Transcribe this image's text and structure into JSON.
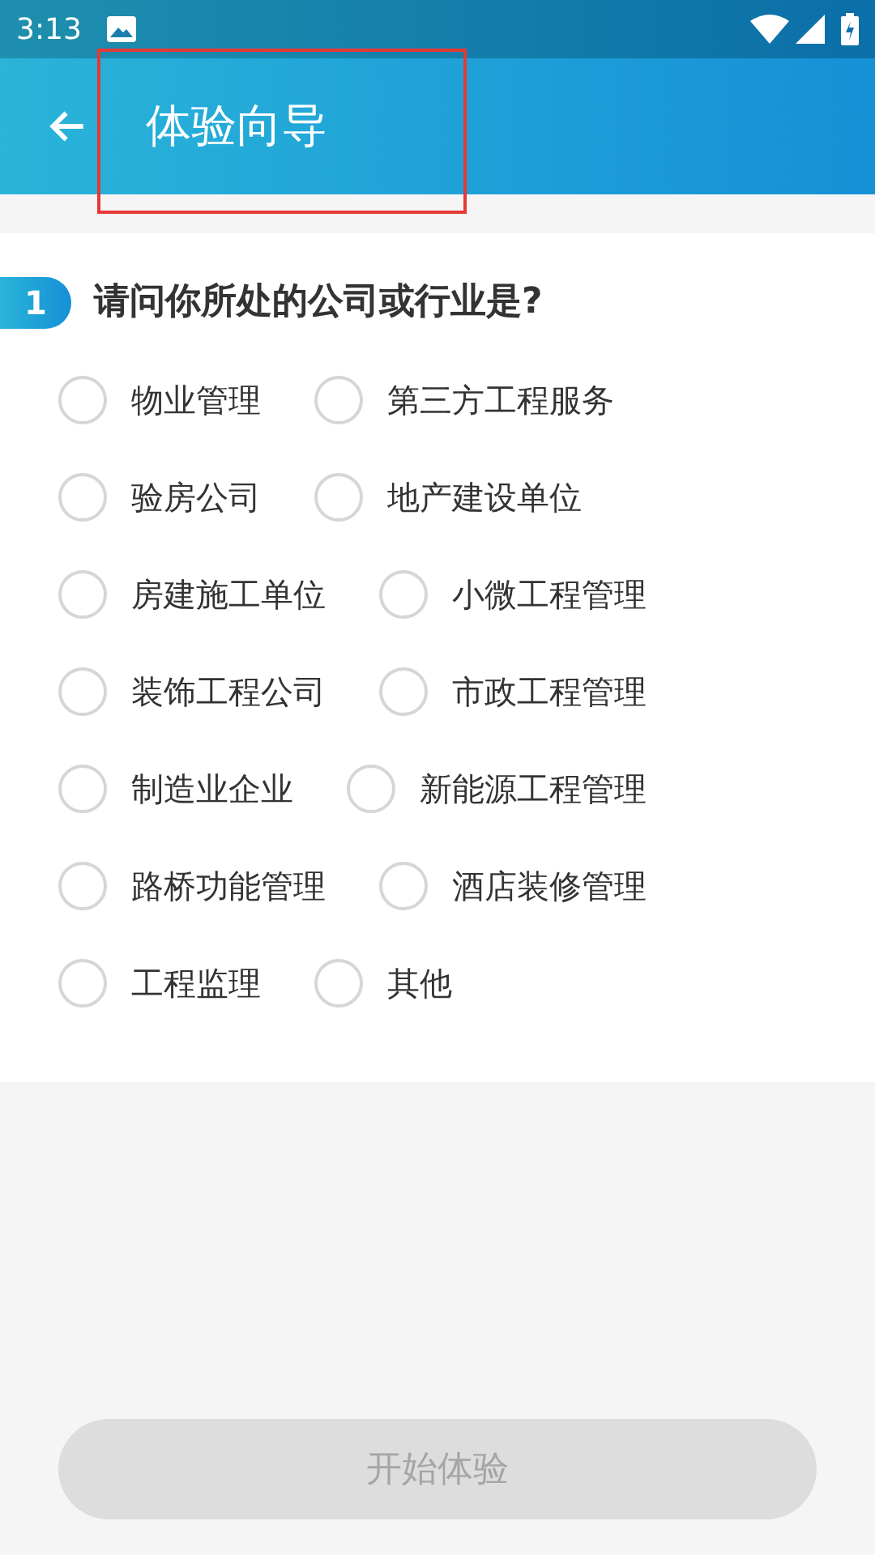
{
  "status_bar": {
    "time": "3:13"
  },
  "app_bar": {
    "title": "体验向导"
  },
  "question": {
    "number": "1",
    "text": "请问你所处的公司或行业是?"
  },
  "options": [
    {
      "label": "物业管理",
      "selected": false
    },
    {
      "label": "第三方工程服务",
      "selected": false
    },
    {
      "label": "验房公司",
      "selected": false
    },
    {
      "label": "地产建设单位",
      "selected": false
    },
    {
      "label": "房建施工单位",
      "selected": false
    },
    {
      "label": "小微工程管理",
      "selected": false
    },
    {
      "label": "装饰工程公司",
      "selected": false
    },
    {
      "label": "市政工程管理",
      "selected": false
    },
    {
      "label": "制造业企业",
      "selected": false
    },
    {
      "label": "新能源工程管理",
      "selected": false
    },
    {
      "label": "路桥功能管理",
      "selected": false
    },
    {
      "label": "酒店装修管理",
      "selected": false
    },
    {
      "label": "工程监理",
      "selected": false
    },
    {
      "label": "其他",
      "selected": false
    }
  ],
  "start_button": {
    "label": "开始体验",
    "disabled": true
  }
}
